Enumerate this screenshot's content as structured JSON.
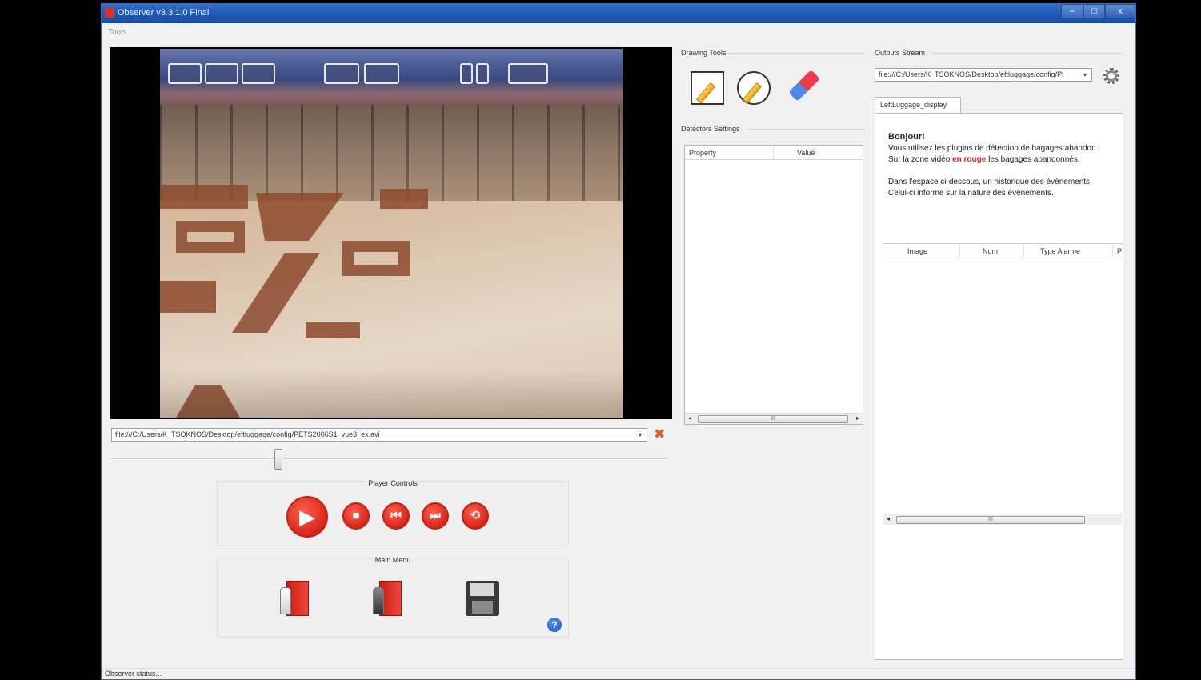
{
  "window": {
    "title": "Observer   v3.3.1.0 Final",
    "controls": {
      "minimize": "–",
      "maximize": "□",
      "close": "x"
    }
  },
  "menu": {
    "tools": "Tools"
  },
  "video": {
    "file_path": "file:///C:/Users/K_TSOKNOS/Desktop/eftluggage/config/PETS2006S1_vue3_ex.avi",
    "dropdown_icon": "chevron-down-icon",
    "remove_icon": "close-icon",
    "seek_position": 0.3
  },
  "player_controls": {
    "title": "Player Controls",
    "buttons": [
      {
        "name": "play",
        "icon": "play-icon",
        "glyph": "▶"
      },
      {
        "name": "stop",
        "icon": "stop-icon",
        "glyph": "■"
      },
      {
        "name": "previous",
        "icon": "skip-back-icon",
        "glyph": "⏮"
      },
      {
        "name": "next",
        "icon": "skip-forward-icon",
        "glyph": "⏭"
      },
      {
        "name": "loop",
        "icon": "loop-icon",
        "glyph": "⟲"
      }
    ],
    "accent": "#d9271a"
  },
  "main_menu": {
    "title": "Main Menu",
    "items": [
      {
        "icon": "exit-door-icon"
      },
      {
        "icon": "camera-door-icon"
      },
      {
        "icon": "floppy-save-icon"
      }
    ],
    "help_glyph": "?"
  },
  "drawing_tools": {
    "title": "Drawing Tools",
    "tools": [
      {
        "icon": "pencil-icon"
      },
      {
        "icon": "circle-pencil-icon"
      },
      {
        "icon": "eraser-icon"
      }
    ]
  },
  "detectors_settings": {
    "title": "Detectors Settings",
    "columns": [
      "Property",
      "Value"
    ],
    "rows": [],
    "scroll": {
      "left": "◂",
      "thumb": "III",
      "right": "▸"
    }
  },
  "outputs_stream": {
    "title": "Outputs Stream",
    "source": "file:///C:/Users/K_TSOKNOS/Desktop/eftluggage/config/Pl",
    "tab": "LeftLuggage_display",
    "info": {
      "greeting": "Bonjour!",
      "line1": "Vous utilisez les plugins de détection de bagages abandon",
      "line2_before": "Sur la zone vidéo ",
      "line2_red": "en rouge",
      "line2_after": " les bagages abandonnés.",
      "line3": "Dans l'espace ci-dessous, un historique des évènements",
      "line4": "Celui-ci informe sur la nature des évènements."
    },
    "columns": [
      "Image",
      "Nom",
      "Type Alarme",
      "P"
    ],
    "scroll": {
      "left": "◂",
      "thumb": "III"
    }
  },
  "status": {
    "text": "Observer status..."
  }
}
